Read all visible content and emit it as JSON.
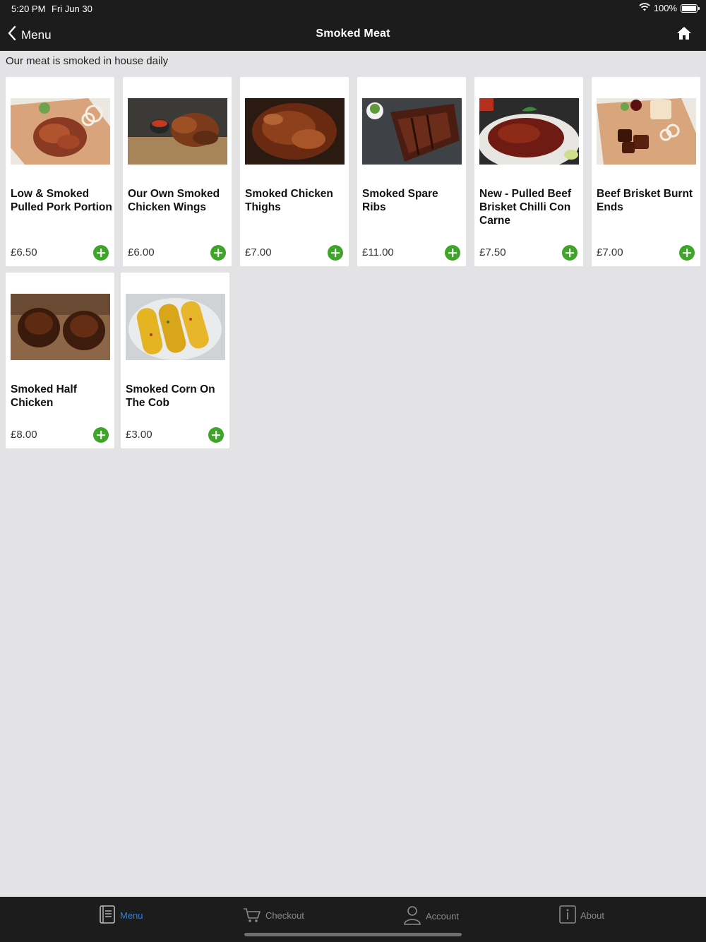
{
  "status_bar": {
    "time": "5:20 PM",
    "date": "Fri Jun 30",
    "battery": "100%",
    "battery_fill": 1.0,
    "wifi_icon": "wifi-icon",
    "battery_icon": "battery-icon"
  },
  "nav": {
    "back_label": "Menu",
    "title": "Smoked Meat",
    "back_icon": "chevron-left-icon",
    "home_icon": "home-icon"
  },
  "subtitle": "Our meat is smoked in house daily",
  "colors": {
    "bar_bg": "#1c1c1c",
    "page_bg": "#e3e3e5",
    "add_green": "#3fa52a",
    "tab_active": "#2f7fe6",
    "tab_inactive": "#8a8a8a"
  },
  "products": [
    {
      "name": "Low & Smoked Pulled Pork Portion",
      "price": "£6.50",
      "image": "pulled-pork-photo"
    },
    {
      "name": "Our Own Smoked Chicken Wings",
      "price": "£6.00",
      "image": "chicken-wings-photo"
    },
    {
      "name": "Smoked Chicken Thighs",
      "price": "£7.00",
      "image": "chicken-thighs-photo"
    },
    {
      "name": "Smoked Spare Ribs",
      "price": "£11.00",
      "image": "spare-ribs-photo"
    },
    {
      "name": "New - Pulled Beef Brisket Chilli Con Carne",
      "price": "£7.50",
      "image": "chilli-con-carne-photo"
    },
    {
      "name": "Beef Brisket Burnt Ends",
      "price": "£7.00",
      "image": "burnt-ends-photo"
    },
    {
      "name": "Smoked Half Chicken",
      "price": "£8.00",
      "image": "half-chicken-photo"
    },
    {
      "name": "Smoked Corn On The Cob",
      "price": "£3.00",
      "image": "corn-on-cob-photo"
    }
  ],
  "tabs": [
    {
      "label": "Menu",
      "icon": "menu-book-icon",
      "active": true
    },
    {
      "label": "Checkout",
      "icon": "cart-icon",
      "active": false
    },
    {
      "label": "Account",
      "icon": "person-icon",
      "active": false
    },
    {
      "label": "About",
      "icon": "info-icon",
      "active": false
    }
  ]
}
